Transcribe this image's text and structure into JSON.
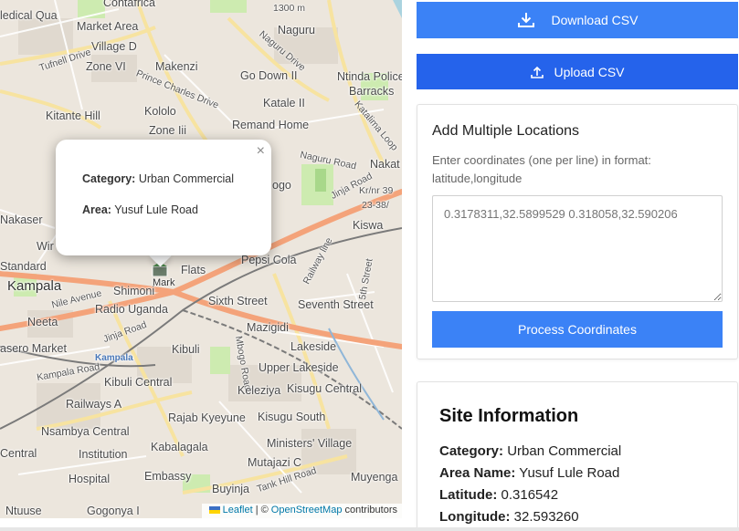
{
  "map": {
    "labels": {
      "medical_qua": "ledical Qua",
      "contafrica": "Contafrica",
      "elevation": "1300 m",
      "naguru": "Naguru",
      "market_area": "Market Area",
      "village_d": "Village D",
      "tufnell_drive": "Tufnell Drive",
      "naguru_drive": "Naguru Drive",
      "zone_vi": "Zone VI",
      "makenzi": "Makenzi",
      "go_down_ii": "Go Down II",
      "ntinda_police": "Ntinda Police",
      "barracks": "Barracks",
      "prince_charles": "Prince Charles Drive",
      "katale_ii": "Katale II",
      "kitante_hill": "Kitante Hill",
      "kololo": "Kololo",
      "remand_home": "Remand Home",
      "zone_iii": "Zone Iii",
      "kataliwa_loop": "Katalima Loop",
      "naguru_road": "Naguru Road",
      "nakat": "Nakat",
      "ogo": "ogo",
      "jinja_road": "Jinja Road",
      "kr_nr": "Kr/nr 39",
      "num_23_38": "23-38/",
      "kiswa": "Kiswa",
      "pepsi_cola": "Pepsi Cola",
      "flats": "Flats",
      "standard": "Standard",
      "kampala": "Kampala",
      "shimoni": "Shimoni",
      "railway_line": "Railway line",
      "fifth_street": "5th Street",
      "nile_avenue": "Nile Avenue",
      "sixth_street": "Sixth Street",
      "seventh_street": "Seventh Street",
      "radio_uganda": "Radio Uganda",
      "neeta": "Neeta",
      "mazigidi": "Mazigidi",
      "jinja_road_2": "Jinja Road",
      "nasero_market": "asero Market",
      "kibuli": "Kibuli",
      "lakeside": "Lakeside",
      "kampala_station": "Kampala",
      "mbogo_road": "Mbogo Road",
      "upper_lakeside": "Upper Lakeside",
      "kibuli_central": "Kibuli Central",
      "keleziya": "Keleziya",
      "kisugu_central": "Kisugu Central",
      "railways_a": "Railways A",
      "rajab_kyeyune": "Rajab Kyeyune",
      "kisugu_south": "Kisugu South",
      "nsambya_central": "Nsambya Central",
      "ministers_village": "Ministers' Village",
      "kabalagala": "Kabalagala",
      "mutajazi_c": "Mutajazi C",
      "institution": "Institution",
      "hospital": "Hospital",
      "embassy": "Embassy",
      "buyinja": "Buyinja",
      "tank_hill_road": "Tank Hill Road",
      "muyenga": "Muyenga",
      "ntuuse": "Ntuuse",
      "gogonya": "Gogonya I",
      "central": "Central",
      "kampala_road_small": "Kampala Road",
      "wir": "Wir",
      "nakase": "Nakaser"
    },
    "marker_label": "Mark",
    "popup": {
      "category_label": "Category:",
      "category_value": "Urban Commercial",
      "area_label": "Area:",
      "area_value": "Yusuf Lule Road",
      "close": "×"
    },
    "attribution": {
      "leaflet": "Leaflet",
      "separator": "| ©",
      "osm": "OpenStreetMap",
      "contributors": "contributors"
    }
  },
  "panel": {
    "download_label": "Download CSV",
    "upload_label": "Upload CSV",
    "multi": {
      "title": "Add Multiple Locations",
      "hint": "Enter coordinates (one per line) in format: latitude,longitude",
      "placeholder": "0.3178311,32.5899529 0.318058,32.590206",
      "process_label": "Process Coordinates"
    },
    "site_info": {
      "title": "Site Information",
      "category_label": "Category:",
      "category_value": "Urban Commercial",
      "area_label": "Area Name:",
      "area_value": "Yusuf Lule Road",
      "latitude_label": "Latitude:",
      "latitude_value": "0.316542",
      "longitude_label": "Longitude:",
      "longitude_value": "32.593260"
    }
  },
  "colors": {
    "download_bg": "#3b82f6",
    "upload_bg": "#2563eb",
    "process_bg": "#3b82f6",
    "map_base": "#ece6dd",
    "road_major": "#f4a37a",
    "road_secondary": "#f7e3a0",
    "park": "#cdebb0",
    "railway": "#7a7a7a"
  }
}
